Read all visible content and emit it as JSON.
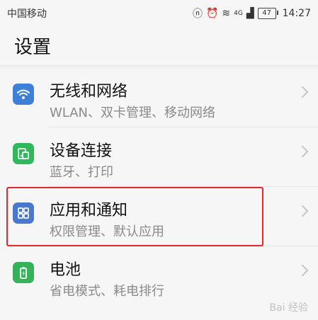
{
  "status_bar": {
    "carrier": "中国移动",
    "network": "4G",
    "battery": "47",
    "time": "14:27"
  },
  "page": {
    "title": "设置"
  },
  "settings": {
    "items": [
      {
        "title": "无线和网络",
        "subtitle": "WLAN、双卡管理、移动网络",
        "icon": "wifi-icon",
        "icon_color": "#3d7fd9"
      },
      {
        "title": "设备连接",
        "subtitle": "蓝牙、打印",
        "icon": "device-connect-icon",
        "icon_color": "#2fb85c"
      },
      {
        "title": "应用和通知",
        "subtitle": "权限管理、默认应用",
        "icon": "apps-icon",
        "icon_color": "#4a78cc",
        "highlighted": true
      },
      {
        "title": "电池",
        "subtitle": "省电模式、耗电排行",
        "icon": "battery-icon",
        "icon_color": "#36b35a"
      }
    ]
  },
  "colors": {
    "highlight_border": "#e0282e",
    "background": "#f6f6f6"
  },
  "watermark": {
    "text": "Bai 经验"
  }
}
